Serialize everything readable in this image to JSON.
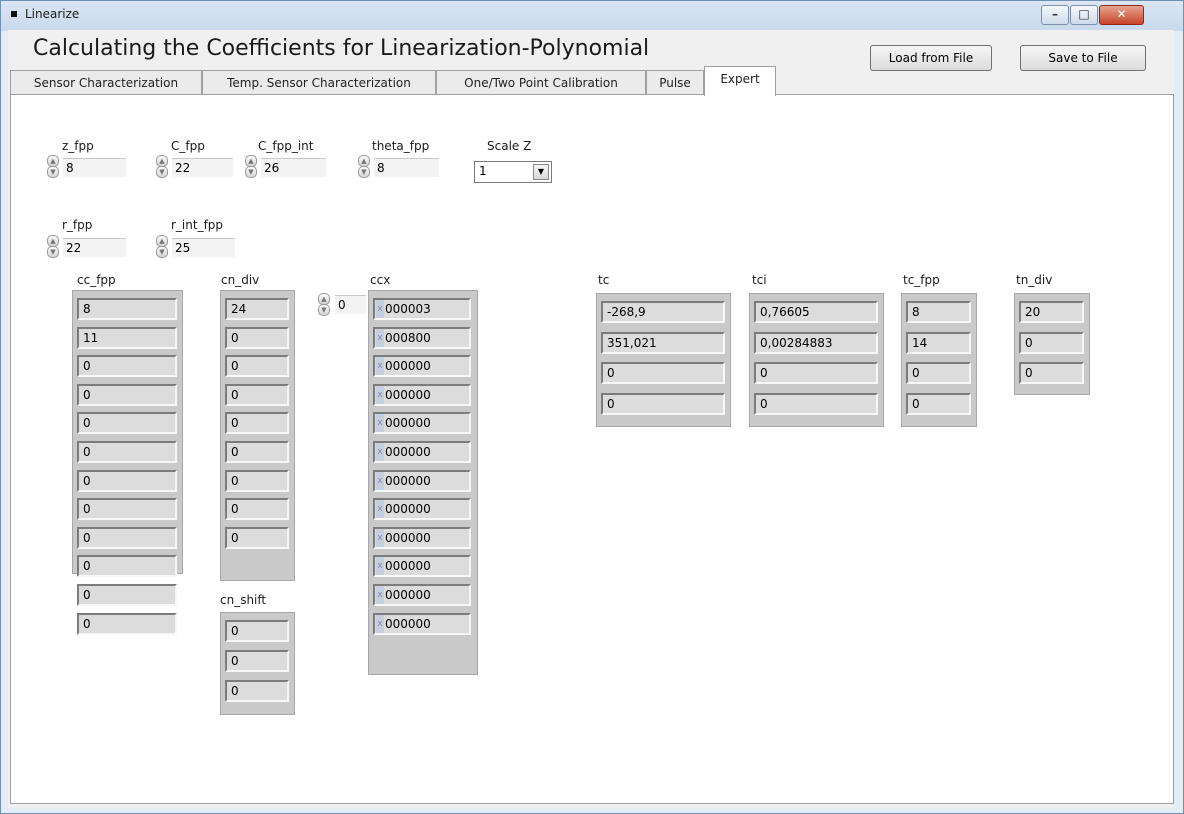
{
  "window": {
    "title": "Linearize"
  },
  "header": {
    "title": "Calculating the Coefficients for Linearization-Polynomial"
  },
  "buttons": {
    "load": "Load from File",
    "save": "Save to File"
  },
  "tabs": [
    {
      "label": "Sensor Characterization"
    },
    {
      "label": "Temp. Sensor Characterization"
    },
    {
      "label": "One/Two Point Calibration"
    },
    {
      "label": "Pulse"
    },
    {
      "label": "Expert"
    }
  ],
  "controls": {
    "z_fpp": {
      "label": "z_fpp",
      "value": "8"
    },
    "C_fpp": {
      "label": "C_fpp",
      "value": "22"
    },
    "C_fpp_int": {
      "label": "C_fpp_int",
      "value": "26"
    },
    "theta_fpp": {
      "label": "theta_fpp",
      "value": "8"
    },
    "scale_z": {
      "label": "Scale Z",
      "value": "1"
    },
    "r_fpp": {
      "label": "r_fpp",
      "value": "22"
    },
    "r_int_fpp": {
      "label": "r_int_fpp",
      "value": "25"
    },
    "ccx_index": {
      "value": "0"
    }
  },
  "arrays": {
    "cc_fpp": {
      "label": "cc_fpp",
      "values": [
        "8",
        "11",
        "0",
        "0",
        "0",
        "0",
        "0",
        "0",
        "0",
        "0",
        "0",
        "0"
      ]
    },
    "cn_div": {
      "label": "cn_div",
      "values": [
        "24",
        "0",
        "0",
        "0",
        "0",
        "0",
        "0",
        "0",
        "0"
      ]
    },
    "cn_shift": {
      "label": "cn_shift",
      "values": [
        "0",
        "0",
        "0"
      ]
    },
    "ccx": {
      "label": "ccx",
      "prefix": "x",
      "values": [
        "000003",
        "000800",
        "000000",
        "000000",
        "000000",
        "000000",
        "000000",
        "000000",
        "000000",
        "000000",
        "000000",
        "000000"
      ]
    },
    "tc": {
      "label": "tc",
      "values": [
        "-268,9",
        "351,021",
        "0",
        "0"
      ]
    },
    "tci": {
      "label": "tci",
      "values": [
        "0,76605",
        "0,00284883",
        "0",
        "0"
      ]
    },
    "tc_fpp": {
      "label": "tc_fpp",
      "values": [
        "8",
        "14",
        "0",
        "0"
      ]
    },
    "tn_div": {
      "label": "tn_div",
      "values": [
        "20",
        "0",
        "0"
      ]
    }
  },
  "icons": {
    "app": "app-icon",
    "minimize": "minimize-icon",
    "maximize": "maximize-icon",
    "close": "close-icon",
    "spin": "increment-decrement-icon",
    "dropdown": "chevron-down-icon"
  },
  "colors": {
    "close": "#c7432a",
    "titlebar": "#c8d8ec",
    "cell": "#dcdcdc"
  }
}
